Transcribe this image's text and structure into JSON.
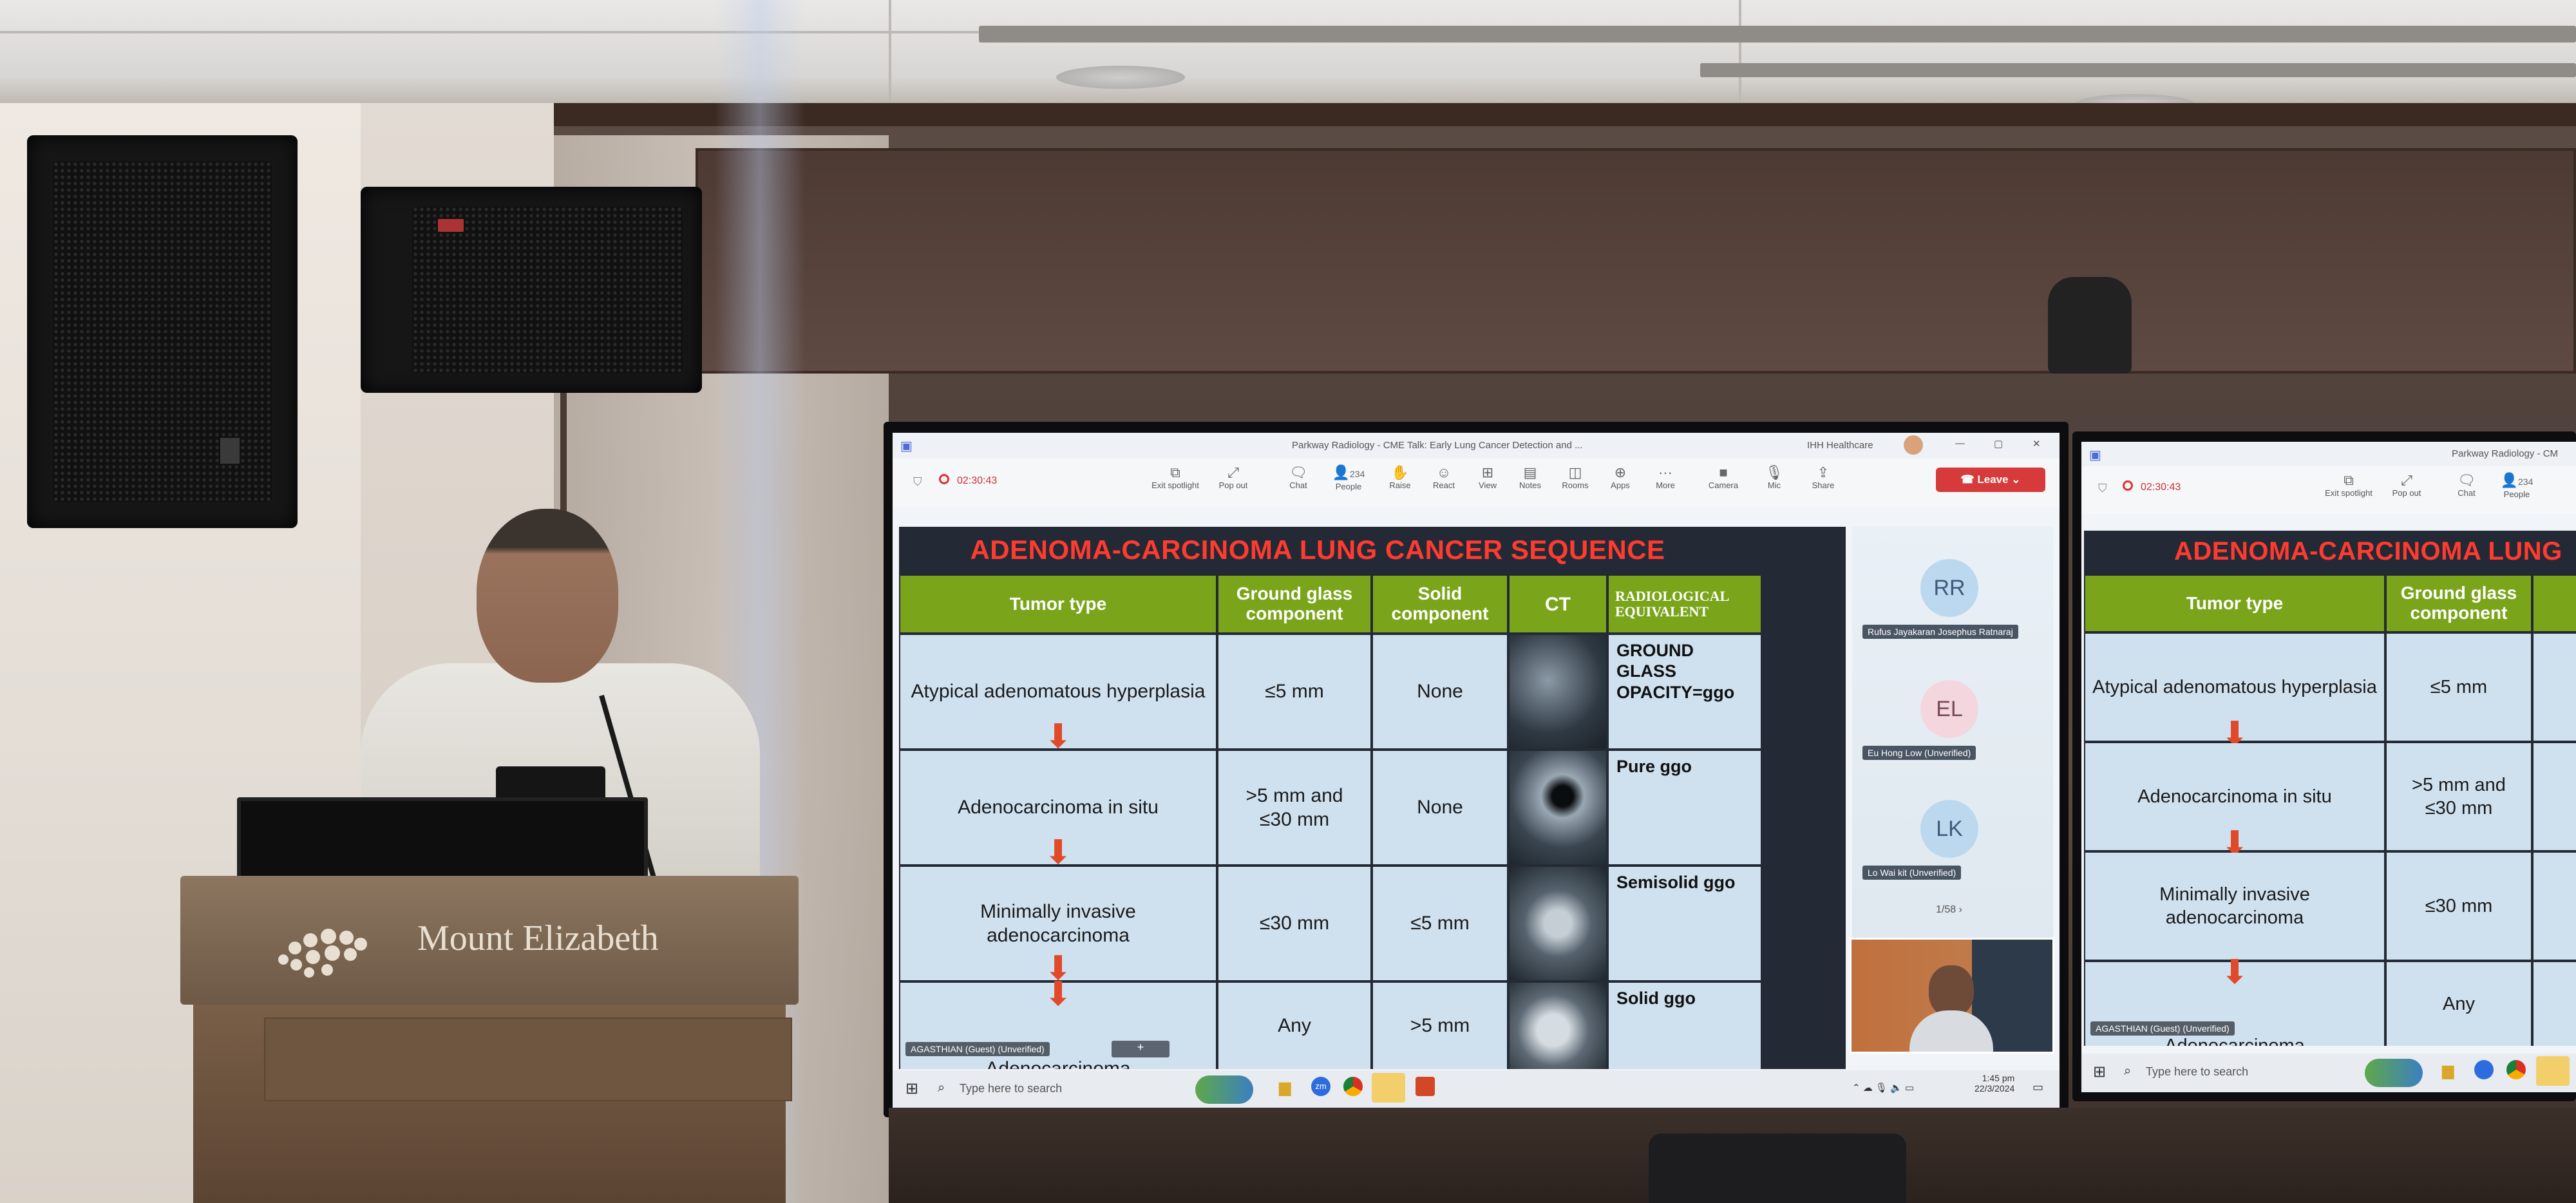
{
  "room": {
    "podium_brand": "Mount Elizabeth"
  },
  "screen_main": {
    "window_title": "Parkway Radiology - CME Talk: Early Lung Cancer Detection and ...",
    "org": "IHH Healthcare",
    "timer": "02:30:43",
    "toolbar": [
      {
        "label": "Exit spotlight",
        "icon": "spotlight-icon"
      },
      {
        "label": "Pop out",
        "icon": "pop-out-icon"
      },
      {
        "label": "Chat",
        "icon": "chat-icon"
      },
      {
        "label": "People",
        "icon": "people-icon",
        "count": "234"
      },
      {
        "label": "Raise",
        "icon": "hand-icon"
      },
      {
        "label": "React",
        "icon": "react-icon"
      },
      {
        "label": "View",
        "icon": "view-icon"
      },
      {
        "label": "Notes",
        "icon": "notes-icon"
      },
      {
        "label": "Rooms",
        "icon": "rooms-icon"
      },
      {
        "label": "Apps",
        "icon": "apps-icon"
      },
      {
        "label": "More",
        "icon": "more-icon"
      },
      {
        "label": "Camera",
        "icon": "camera-icon"
      },
      {
        "label": "Mic",
        "icon": "mic-icon"
      },
      {
        "label": "Share",
        "icon": "share-icon"
      }
    ],
    "leave_label": "Leave",
    "slide": {
      "title": "ADENOMA-CARCINOMA LUNG CANCER SEQUENCE",
      "headers": {
        "tumor_type": "Tumor type",
        "ground_glass": "Ground glass component",
        "solid": "Solid component",
        "ct": "CT",
        "radiological": "RADIOLOGICAL EQUIVALENT"
      },
      "rows": [
        {
          "tumor_type": "Atypical adenomatous hyperplasia",
          "ground_glass": "≤5 mm",
          "solid": "None",
          "radiological": "GROUND GLASS OPACITY=ggo"
        },
        {
          "tumor_type": "Adenocarcinoma in situ",
          "ground_glass": ">5 mm and ≤30 mm",
          "solid": "None",
          "radiological": "Pure ggo"
        },
        {
          "tumor_type": "Minimally invasive adenocarcinoma",
          "ground_glass": "≤30 mm",
          "solid": "≤5 mm",
          "radiological": "Semisolid ggo"
        },
        {
          "tumor_type": "Adenocarcinoma",
          "ground_glass": "Any",
          "solid": ">5 mm",
          "radiological": "Solid ggo"
        }
      ],
      "presenter_tag": "AGASTHIAN (Guest) (Unverified)"
    },
    "participants": [
      {
        "initials": "RR",
        "name": "Rufus Jayakaran Josephus Ratnaraj",
        "color": "#bcd8ef"
      },
      {
        "initials": "EL",
        "name": "Eu Hong Low (Unverified)",
        "color": "#f3d6de"
      },
      {
        "initials": "LK",
        "name": "Lo Wai kit (Unverified)",
        "color": "#bcd8ef"
      }
    ],
    "page_indicator": "1/58",
    "taskbar": {
      "search_placeholder": "Type here to search",
      "time": "1:45 pm",
      "date": "22/3/2024"
    }
  },
  "screen_right": {
    "window_title": "Parkway Radiology - CM",
    "timer": "02:30:43",
    "toolbar": [
      "Exit spotlight",
      "Pop out",
      "Chat",
      "People"
    ],
    "people_count": "234",
    "slide": {
      "title": "ADENOMA-CARCINOMA LUNG",
      "headers": {
        "tumor_type": "Tumor type",
        "ground_glass": "Ground glass component"
      },
      "rows": [
        {
          "tumor_type": "Atypical adenomatous hyperplasia",
          "ground_glass": "≤5 mm"
        },
        {
          "tumor_type": "Adenocarcinoma in situ",
          "ground_glass": ">5 mm and ≤30 mm"
        },
        {
          "tumor_type": "Minimally invasive adenocarcinoma",
          "ground_glass": "≤30 mm"
        },
        {
          "tumor_type": "Adenocarcinoma",
          "ground_glass": "Any"
        }
      ],
      "presenter_tag": "AGASTHIAN (Guest) (Unverified)"
    },
    "taskbar": {
      "search_placeholder": "Type here to search"
    }
  }
}
